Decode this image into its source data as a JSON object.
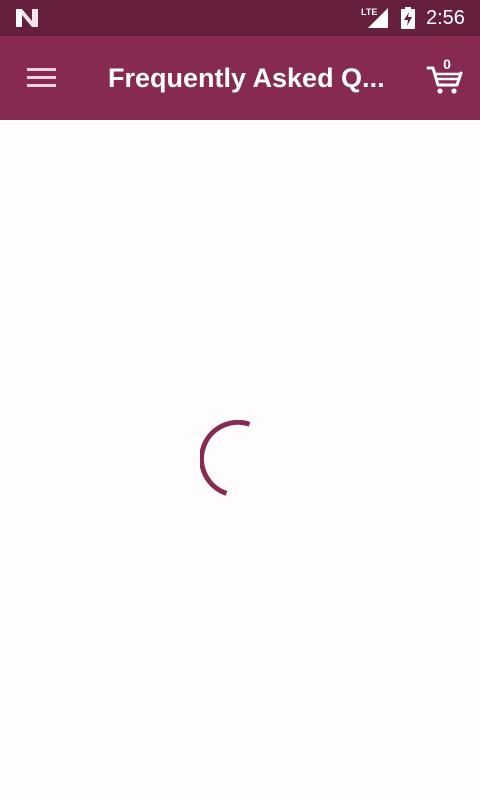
{
  "status_bar": {
    "time": "2:56",
    "network_label": "LTE",
    "icons": [
      "n-logo-icon",
      "lte-signal-icon",
      "battery-charging-icon"
    ]
  },
  "app_bar": {
    "title": "Frequently Asked Q...",
    "cart_count": "0",
    "icons": [
      "hamburger-menu-icon",
      "shopping-cart-icon"
    ]
  },
  "content": {
    "state": "loading",
    "spinner_icon": "loading-spinner-icon"
  },
  "colors": {
    "status_bar": "#66203e",
    "app_bar": "#862a52",
    "accent": "#862a52",
    "background": "#fefcfd"
  }
}
